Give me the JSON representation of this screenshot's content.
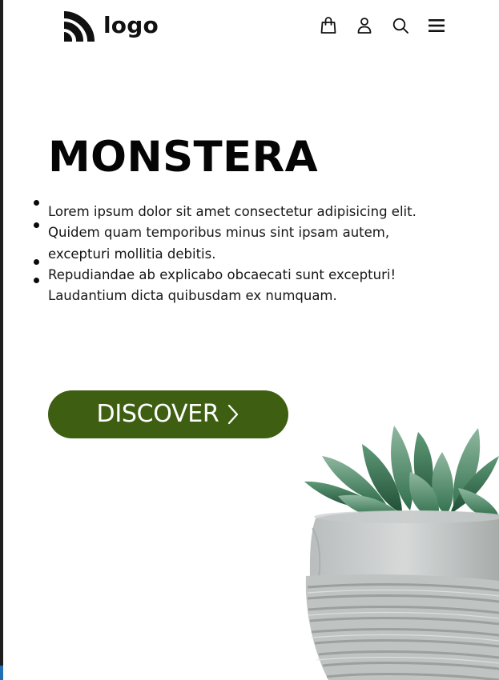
{
  "header": {
    "logo_text": "logo",
    "icons": [
      "shopping-bag-icon",
      "user-icon",
      "search-icon",
      "menu-icon"
    ]
  },
  "hero": {
    "title": "MONSTERA",
    "description_items": [
      "Lorem ipsum dolor sit amet consectetur adipisicing elit. Quidem quam temporibus minus sint ipsam autem, excepturi mollitia debitis.",
      "Repudiandae ab explicabo obcaecati sunt excepturi! Laudantium dicta quibusdam ex numquam."
    ],
    "cta_label": "DISCOVER"
  },
  "colors": {
    "accent": "#3e5f12",
    "text": "#111111",
    "background": "#ffffff"
  }
}
